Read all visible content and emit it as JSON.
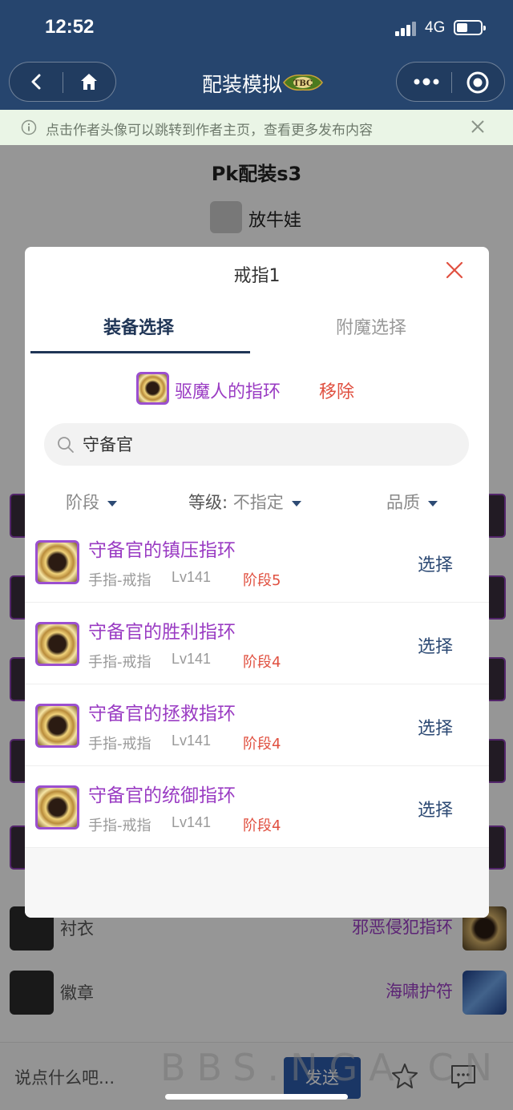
{
  "status_bar": {
    "time": "12:52",
    "network": "4G"
  },
  "nav": {
    "title": "配装模拟"
  },
  "notice": {
    "text": "点击作者头像可以跳转到作者主页，查看更多发布内容"
  },
  "page": {
    "title": "Pk配装s3",
    "author": "放牛娃",
    "rows": [
      {
        "label": "衬衣",
        "item": "邪恶侵犯指环"
      },
      {
        "label": "徽章",
        "item": "海啸护符"
      }
    ],
    "watermark": "BBS.NGA.CN"
  },
  "modal": {
    "title": "戒指1",
    "tabs": [
      {
        "label": "装备选择",
        "active": true
      },
      {
        "label": "附魔选择",
        "active": false
      }
    ],
    "current": {
      "name": "驱魔人的指环",
      "remove_label": "移除"
    },
    "search": {
      "value": "守备官"
    },
    "filters": {
      "stage": "阶段",
      "level_label": "等级:",
      "level_value": "不指定",
      "quality": "品质"
    },
    "results": [
      {
        "name": "守备官的镇压指环",
        "slot": "手指-戒指",
        "level": "Lv141",
        "stage": "阶段5",
        "action": "选择"
      },
      {
        "name": "守备官的胜利指环",
        "slot": "手指-戒指",
        "level": "Lv141",
        "stage": "阶段4",
        "action": "选择"
      },
      {
        "name": "守备官的拯救指环",
        "slot": "手指-戒指",
        "level": "Lv141",
        "stage": "阶段4",
        "action": "选择"
      },
      {
        "name": "守备官的统御指环",
        "slot": "手指-戒指",
        "level": "Lv141",
        "stage": "阶段4",
        "action": "选择"
      }
    ]
  },
  "bottom_bar": {
    "placeholder": "说点什么吧...",
    "send_label": "发送"
  },
  "colors": {
    "nav_bg": "#26456e",
    "notice_bg": "#eaf5e6",
    "epic_purple": "#9a3cc3",
    "remove_red": "#e05040",
    "accent_navy": "#1f3556",
    "send_blue": "#2c5aa8"
  },
  "icons": [
    "back-icon",
    "home-icon",
    "more-icon",
    "target-icon",
    "info-icon",
    "close-icon",
    "search-icon",
    "caret-down-icon",
    "star-icon",
    "chat-icon"
  ]
}
